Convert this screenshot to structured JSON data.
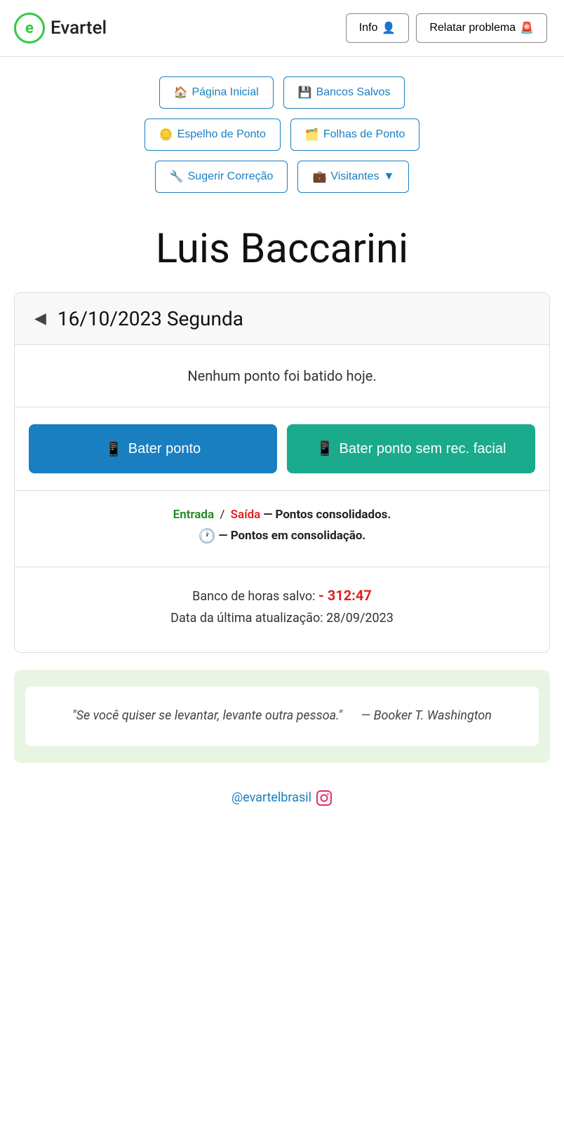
{
  "header": {
    "logo_letter": "e",
    "logo_name": "Evartel",
    "btn_info_label": "Info",
    "btn_info_icon": "👤",
    "btn_report_label": "Relatar problema",
    "btn_report_icon": "🚨"
  },
  "nav": {
    "row1": [
      {
        "id": "pagina-inicial",
        "icon": "🏠",
        "label": "Página Inicial"
      },
      {
        "id": "bancos-salvos",
        "icon": "💾",
        "label": "Bancos Salvos"
      }
    ],
    "row2": [
      {
        "id": "espelho-ponto",
        "icon": "🪙",
        "label": "Espelho de Ponto"
      },
      {
        "id": "folhas-ponto",
        "icon": "🗂️",
        "label": "Folhas de Ponto"
      }
    ],
    "row3": [
      {
        "id": "sugerir-correcao",
        "icon": "🔧",
        "label": "Sugerir Correção"
      },
      {
        "id": "visitantes",
        "icon": "💼",
        "label": "Visitantes",
        "has_arrow": true
      }
    ]
  },
  "page_title": "Luis Baccarini",
  "date_card": {
    "date_display": "16/10/2023 Segunda",
    "no_punch_message": "Nenhum ponto foi batido hoje.",
    "btn_bater_icon": "📱",
    "btn_bater_label": "Bater ponto",
    "btn_bater_sem_icon": "📱",
    "btn_bater_sem_label": "Bater ponto sem rec. facial",
    "legend_entrada": "Entrada",
    "legend_divider": "/",
    "legend_saida": "Saída",
    "legend_consolidated": "— Pontos consolidados.",
    "legend_clock": "🕐",
    "legend_consolidating": "— Pontos em consolidação.",
    "banco_label": "Banco de horas salvo:",
    "banco_value": "- 312:47",
    "update_label": "Data da última atualização:",
    "update_date": "28/09/2023"
  },
  "quote": {
    "text": "\"Se você quiser se levantar, levante outra pessoa.\"",
    "author": "— Booker T. Washington"
  },
  "footer": {
    "instagram_handle": "@evartelbrasil",
    "instagram_icon": "📷"
  }
}
